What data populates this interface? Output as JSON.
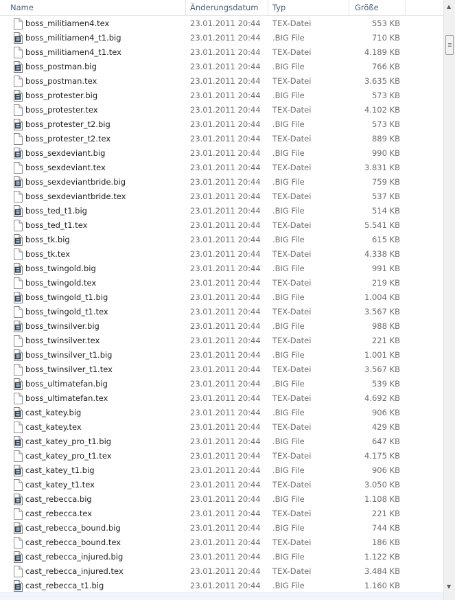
{
  "columns": {
    "name": "Name",
    "modified": "Änderungsdatum",
    "type": "Typ",
    "size": "Größe"
  },
  "sort_indicator": "^",
  "scrollbar": {
    "up_arrow": "▲",
    "down_arrow": "▼"
  },
  "files": [
    {
      "name": "boss_militiamen4.tex",
      "modified": "23.01.2011 20:44",
      "type": "TEX-Datei",
      "size": "553 KB",
      "icon": "blank-file-icon"
    },
    {
      "name": "boss_militiamen4_t1.big",
      "modified": "23.01.2011 20:44",
      "type": ".BIG File",
      "size": "710 KB",
      "icon": "big-file-icon"
    },
    {
      "name": "boss_militiamen4_t1.tex",
      "modified": "23.01.2011 20:44",
      "type": "TEX-Datei",
      "size": "4.189 KB",
      "icon": "blank-file-icon"
    },
    {
      "name": "boss_postman.big",
      "modified": "23.01.2011 20:44",
      "type": ".BIG File",
      "size": "766 KB",
      "icon": "big-file-icon"
    },
    {
      "name": "boss_postman.tex",
      "modified": "23.01.2011 20:44",
      "type": "TEX-Datei",
      "size": "3.635 KB",
      "icon": "blank-file-icon"
    },
    {
      "name": "boss_protester.big",
      "modified": "23.01.2011 20:44",
      "type": ".BIG File",
      "size": "573 KB",
      "icon": "big-file-icon"
    },
    {
      "name": "boss_protester.tex",
      "modified": "23.01.2011 20:44",
      "type": "TEX-Datei",
      "size": "4.102 KB",
      "icon": "blank-file-icon"
    },
    {
      "name": "boss_protester_t2.big",
      "modified": "23.01.2011 20:44",
      "type": ".BIG File",
      "size": "573 KB",
      "icon": "big-file-icon"
    },
    {
      "name": "boss_protester_t2.tex",
      "modified": "23.01.2011 20:44",
      "type": "TEX-Datei",
      "size": "889 KB",
      "icon": "blank-file-icon"
    },
    {
      "name": "boss_sexdeviant.big",
      "modified": "23.01.2011 20:44",
      "type": ".BIG File",
      "size": "990 KB",
      "icon": "big-file-icon"
    },
    {
      "name": "boss_sexdeviant.tex",
      "modified": "23.01.2011 20:44",
      "type": "TEX-Datei",
      "size": "3.831 KB",
      "icon": "blank-file-icon"
    },
    {
      "name": "boss_sexdeviantbride.big",
      "modified": "23.01.2011 20:44",
      "type": ".BIG File",
      "size": "759 KB",
      "icon": "big-file-icon"
    },
    {
      "name": "boss_sexdeviantbride.tex",
      "modified": "23.01.2011 20:44",
      "type": "TEX-Datei",
      "size": "537 KB",
      "icon": "blank-file-icon"
    },
    {
      "name": "boss_ted_t1.big",
      "modified": "23.01.2011 20:44",
      "type": ".BIG File",
      "size": "514 KB",
      "icon": "big-file-icon"
    },
    {
      "name": "boss_ted_t1.tex",
      "modified": "23.01.2011 20:44",
      "type": "TEX-Datei",
      "size": "5.541 KB",
      "icon": "blank-file-icon"
    },
    {
      "name": "boss_tk.big",
      "modified": "23.01.2011 20:44",
      "type": ".BIG File",
      "size": "615 KB",
      "icon": "big-file-icon"
    },
    {
      "name": "boss_tk.tex",
      "modified": "23.01.2011 20:44",
      "type": "TEX-Datei",
      "size": "4.338 KB",
      "icon": "blank-file-icon"
    },
    {
      "name": "boss_twingold.big",
      "modified": "23.01.2011 20:44",
      "type": ".BIG File",
      "size": "991 KB",
      "icon": "big-file-icon"
    },
    {
      "name": "boss_twingold.tex",
      "modified": "23.01.2011 20:44",
      "type": "TEX-Datei",
      "size": "219 KB",
      "icon": "blank-file-icon"
    },
    {
      "name": "boss_twingold_t1.big",
      "modified": "23.01.2011 20:44",
      "type": ".BIG File",
      "size": "1.004 KB",
      "icon": "big-file-icon"
    },
    {
      "name": "boss_twingold_t1.tex",
      "modified": "23.01.2011 20:44",
      "type": "TEX-Datei",
      "size": "3.567 KB",
      "icon": "blank-file-icon"
    },
    {
      "name": "boss_twinsilver.big",
      "modified": "23.01.2011 20:44",
      "type": ".BIG File",
      "size": "988 KB",
      "icon": "big-file-icon"
    },
    {
      "name": "boss_twinsilver.tex",
      "modified": "23.01.2011 20:44",
      "type": "TEX-Datei",
      "size": "221 KB",
      "icon": "blank-file-icon"
    },
    {
      "name": "boss_twinsilver_t1.big",
      "modified": "23.01.2011 20:44",
      "type": ".BIG File",
      "size": "1.001 KB",
      "icon": "big-file-icon"
    },
    {
      "name": "boss_twinsilver_t1.tex",
      "modified": "23.01.2011 20:44",
      "type": "TEX-Datei",
      "size": "3.567 KB",
      "icon": "blank-file-icon"
    },
    {
      "name": "boss_ultimatefan.big",
      "modified": "23.01.2011 20:44",
      "type": ".BIG File",
      "size": "539 KB",
      "icon": "big-file-icon"
    },
    {
      "name": "boss_ultimatefan.tex",
      "modified": "23.01.2011 20:44",
      "type": "TEX-Datei",
      "size": "4.692 KB",
      "icon": "blank-file-icon"
    },
    {
      "name": "cast_katey.big",
      "modified": "23.01.2011 20:44",
      "type": ".BIG File",
      "size": "906 KB",
      "icon": "big-file-icon"
    },
    {
      "name": "cast_katey.tex",
      "modified": "23.01.2011 20:44",
      "type": "TEX-Datei",
      "size": "429 KB",
      "icon": "blank-file-icon"
    },
    {
      "name": "cast_katey_pro_t1.big",
      "modified": "23.01.2011 20:44",
      "type": ".BIG File",
      "size": "647 KB",
      "icon": "big-file-icon"
    },
    {
      "name": "cast_katey_pro_t1.tex",
      "modified": "23.01.2011 20:44",
      "type": "TEX-Datei",
      "size": "4.175 KB",
      "icon": "blank-file-icon"
    },
    {
      "name": "cast_katey_t1.big",
      "modified": "23.01.2011 20:44",
      "type": ".BIG File",
      "size": "906 KB",
      "icon": "big-file-icon"
    },
    {
      "name": "cast_katey_t1.tex",
      "modified": "23.01.2011 20:44",
      "type": "TEX-Datei",
      "size": "3.050 KB",
      "icon": "blank-file-icon"
    },
    {
      "name": "cast_rebecca.big",
      "modified": "23.01.2011 20:44",
      "type": ".BIG File",
      "size": "1.108 KB",
      "icon": "big-file-icon"
    },
    {
      "name": "cast_rebecca.tex",
      "modified": "23.01.2011 20:44",
      "type": "TEX-Datei",
      "size": "221 KB",
      "icon": "blank-file-icon"
    },
    {
      "name": "cast_rebecca_bound.big",
      "modified": "23.01.2011 20:44",
      "type": ".BIG File",
      "size": "744 KB",
      "icon": "big-file-icon"
    },
    {
      "name": "cast_rebecca_bound.tex",
      "modified": "23.01.2011 20:44",
      "type": "TEX-Datei",
      "size": "186 KB",
      "icon": "blank-file-icon"
    },
    {
      "name": "cast_rebecca_injured.big",
      "modified": "23.01.2011 20:44",
      "type": ".BIG File",
      "size": "1.122 KB",
      "icon": "big-file-icon"
    },
    {
      "name": "cast_rebecca_injured.tex",
      "modified": "23.01.2011 20:44",
      "type": "TEX-Datei",
      "size": "3.484 KB",
      "icon": "blank-file-icon"
    },
    {
      "name": "cast_rebecca_t1.big",
      "modified": "23.01.2011 20:44",
      "type": ".BIG File",
      "size": "1.160 KB",
      "icon": "big-file-icon"
    }
  ]
}
